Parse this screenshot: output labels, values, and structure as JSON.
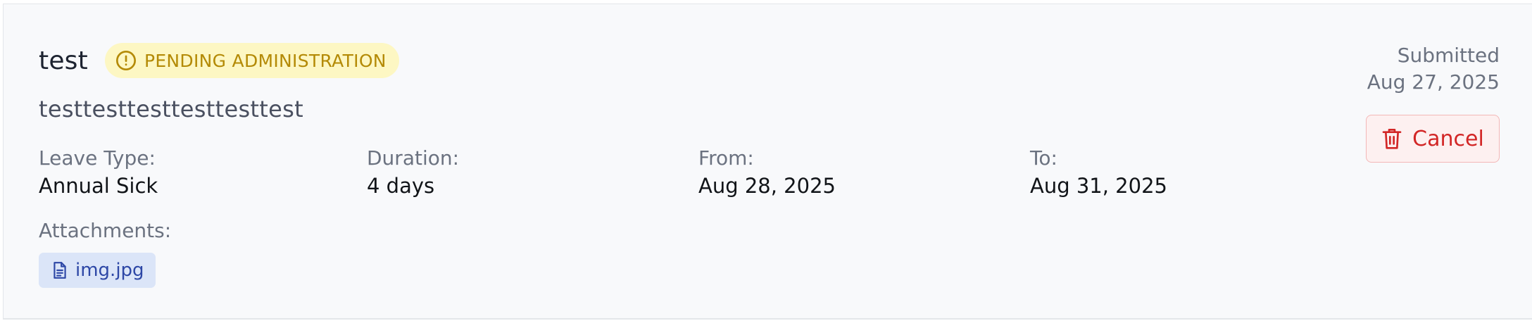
{
  "request": {
    "title": "test",
    "status": "PENDING ADMINISTRATION",
    "description": "testtesttesttesttesttest",
    "submitted_label": "Submitted",
    "submitted_date": "Aug 27, 2025",
    "cancel_label": "Cancel"
  },
  "fields": [
    {
      "label": "Leave Type:",
      "value": "Annual Sick"
    },
    {
      "label": "Duration:",
      "value": "4 days"
    },
    {
      "label": "From:",
      "value": "Aug 28, 2025"
    },
    {
      "label": "To:",
      "value": "Aug 31, 2025"
    }
  ],
  "attachments": {
    "label": "Attachments:",
    "files": [
      {
        "name": "img.jpg",
        "icon": "file-icon"
      }
    ]
  },
  "colors": {
    "status_bg": "#fdf7c3",
    "status_text": "#b48a06",
    "danger": "#d22626",
    "attachment_bg": "#dbe5f8",
    "attachment_text": "#2d47a6"
  }
}
